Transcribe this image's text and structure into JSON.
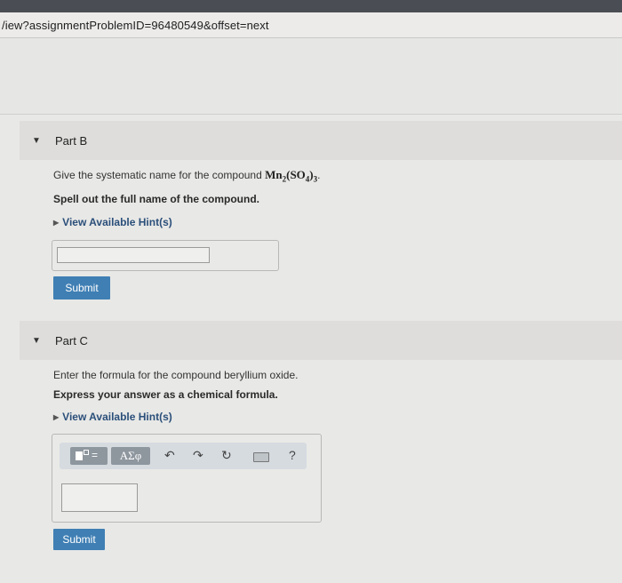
{
  "browser": {
    "url_text": "/iew?assignmentProblemID=96480549&offset=next"
  },
  "part_b": {
    "title": "Part B",
    "question_prefix": "Give the systematic name for the compound ",
    "formula_main": "Mn",
    "formula_sub1": "2",
    "formula_paren": "(SO",
    "formula_sub2": "4",
    "formula_close": ")",
    "formula_sub3": "3",
    "formula_end": ".",
    "instruction": "Spell out the full name of the compound.",
    "hint_label": "View Available Hint(s)",
    "answer_value": "",
    "submit_label": "Submit"
  },
  "part_c": {
    "title": "Part C",
    "question": "Enter the formula for the compound beryllium oxide.",
    "instruction": "Express your answer as a chemical formula.",
    "hint_label": "View Available Hint(s)",
    "toolbar": {
      "greek_label": "ΑΣφ",
      "undo_icon": "undo-icon",
      "redo_icon": "redo-icon",
      "reset_icon": "reset-icon",
      "keyboard_icon": "keyboard-icon",
      "help_label": "?"
    },
    "answer_value": "",
    "submit_label": "Submit"
  },
  "colors": {
    "accent": "#3f7fb4",
    "hint_link": "#2b4f7a"
  }
}
